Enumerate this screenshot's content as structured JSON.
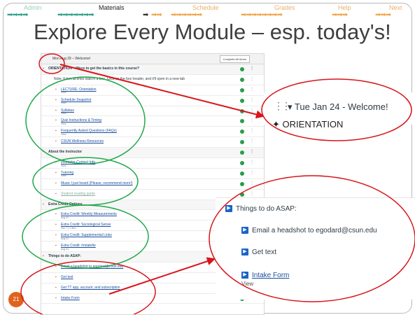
{
  "nav": {
    "items": [
      {
        "label": "Admin",
        "state": "done"
      },
      {
        "label": "Materials",
        "state": "active"
      },
      {
        "label": "Schedule",
        "state": "todo"
      },
      {
        "label": "Grades",
        "state": "todo"
      },
      {
        "label": "Help",
        "state": "todo"
      },
      {
        "label": "Next",
        "state": "todo"
      }
    ],
    "arrow_glyph": "➡"
  },
  "title": "Explore Every Module – esp. today's!",
  "panel": {
    "header": "Mon Aug 29 – Welcome!",
    "header_button": "Complete All Items",
    "rows": [
      {
        "text": "ORIENTATION – Ways to get the basics in this course?",
        "kind": "section"
      },
      {
        "text": "Note: External links load in a box. Click on the box header, and it'll open in a new tab",
        "kind": "note"
      },
      {
        "text": "LECTURE: Orientation",
        "sub": "View",
        "kind": "item"
      },
      {
        "text": "Schedule Snapshot",
        "sub": "View",
        "kind": "item"
      },
      {
        "text": "Syllabus",
        "sub": "View",
        "kind": "item"
      },
      {
        "text": "Quiz Instructions & Timing",
        "sub": "View",
        "kind": "item"
      },
      {
        "text": "Frequently Asked Questions (FAQs)",
        "sub": "View",
        "kind": "item"
      },
      {
        "text": "CSUN Wellness Resources",
        "kind": "item"
      },
      {
        "text": "About the Instructor",
        "kind": "section"
      },
      {
        "text": "Instructor Contact Info",
        "sub": "View",
        "kind": "item"
      },
      {
        "text": "Tutoring",
        "sub": "View",
        "kind": "item"
      },
      {
        "text": "Music I just heard (Please, recommend more!)",
        "kind": "item"
      },
      {
        "text": "Student reading guide",
        "kind": "grey"
      },
      {
        "text": "Extra Credit Options",
        "kind": "section"
      },
      {
        "text": "Extra Credit: Weekly Measurements",
        "sub": "Aug 31",
        "kind": "item"
      },
      {
        "text": "Extra Credit: Sociological Sense",
        "sub": "Dec 7 | 1 item",
        "kind": "item"
      },
      {
        "text": "Extra Credit: Supplemental Links",
        "sub": "Aug 31",
        "kind": "item"
      },
      {
        "text": "Extra Credit: #relatefie",
        "sub": "Aug 31",
        "kind": "item"
      },
      {
        "text": "Things to do ASAP:",
        "kind": "section"
      },
      {
        "text": "Email a headshot to egodard@csun.edu",
        "kind": "item"
      },
      {
        "text": "Get text",
        "kind": "item"
      },
      {
        "text": "Get TT app, account, and subscription",
        "kind": "item"
      },
      {
        "text": "Intake Form",
        "kind": "item"
      }
    ]
  },
  "zoom_top": {
    "label": "Tue Jan 24 - Welcome!",
    "cut_text": "ORIENTATION"
  },
  "zoom_bottom": {
    "heading": "Things to do ASAP:",
    "items": [
      "Email a headshot to egodard@csun.edu",
      "Get text"
    ],
    "form": "Intake Form",
    "form_sub": "View"
  },
  "page_number": "21",
  "colors": {
    "accent_orange": "#f0a64b",
    "accent_teal": "#2fa08a",
    "callout_red": "#d9141a",
    "highlight_green": "#1fa84a",
    "canvas_blue": "#1a65c8",
    "badge": "#e0621e"
  }
}
